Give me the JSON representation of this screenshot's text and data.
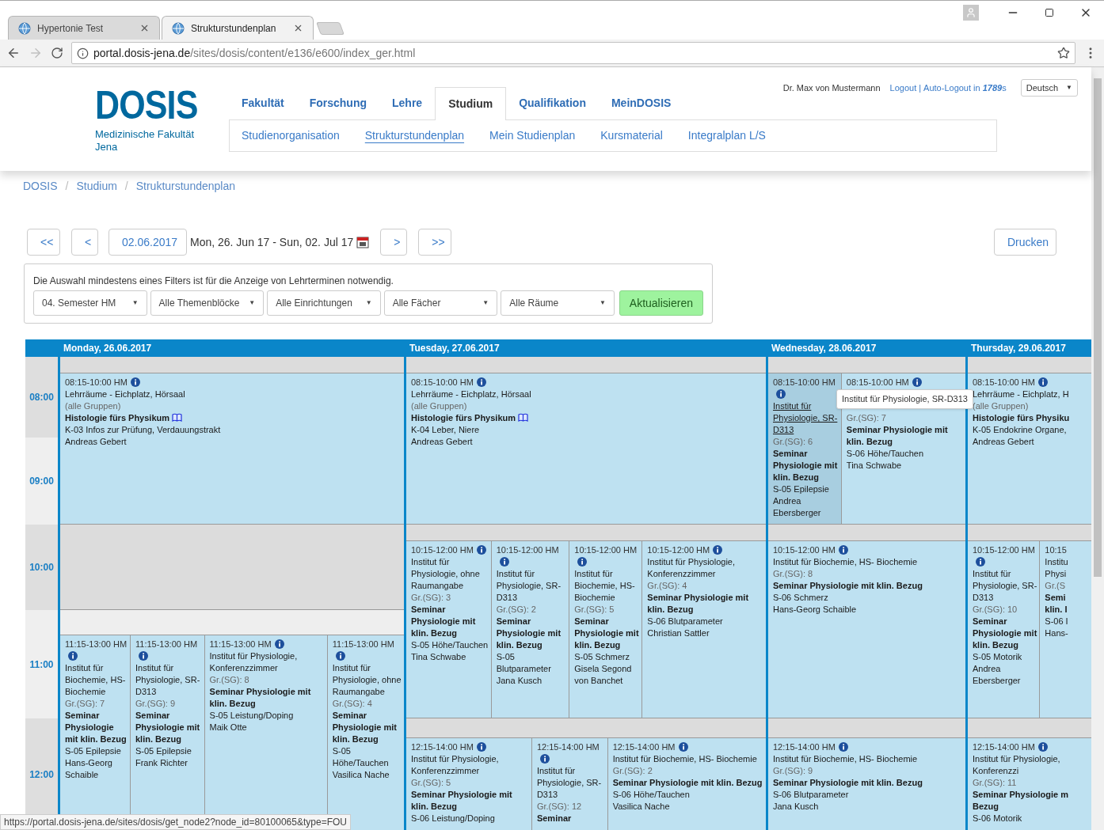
{
  "browser": {
    "tabs": [
      {
        "title": "Hypertonie Test",
        "selected": false
      },
      {
        "title": "Strukturstundenplan",
        "selected": true
      }
    ],
    "url_host": "portal.dosis-jena.de",
    "url_path": "/sites/dosis/content/e136/e600/index_ger.html"
  },
  "logo": {
    "title": "DOSIS",
    "line_1": "Medizinische Fakultät",
    "line_2": "Jena"
  },
  "user": {
    "name": "Dr. Max von Mustermann",
    "logout": "Logout",
    "separator": "|",
    "auto_logout": "Auto-Logout in",
    "seconds": "1789",
    "seconds_unit": "s",
    "language": "Deutsch",
    "language_caret": "▼"
  },
  "main_nav": [
    {
      "label": "Fakultät",
      "selected": false
    },
    {
      "label": "Forschung",
      "selected": false
    },
    {
      "label": "Lehre",
      "selected": false
    },
    {
      "label": "Studium",
      "selected": true
    },
    {
      "label": "Qualifikation",
      "selected": false
    },
    {
      "label": "MeinDOSIS",
      "selected": false
    }
  ],
  "sub_nav": [
    {
      "label": "Studienorganisation",
      "selected": false
    },
    {
      "label": "Strukturstundenplan",
      "selected": true
    },
    {
      "label": "Mein Studienplan",
      "selected": false
    },
    {
      "label": "Kursmaterial",
      "selected": false
    },
    {
      "label": "Integralplan L/S",
      "selected": false
    }
  ],
  "breadcrumb": {
    "separator": "/",
    "items": [
      "DOSIS",
      "Studium",
      "Strukturstundenplan"
    ]
  },
  "toolbar": {
    "first": "<<",
    "prev": "<",
    "date": "02.06.2017",
    "range": "Mon, 26. Jun 17 - Sun, 02. Jul 17",
    "next": ">",
    "last": ">>",
    "print": "Drucken"
  },
  "filter": {
    "note": "Die Auswahl mindestens eines Filters ist für die Anzeige von Lehrterminen notwendig.",
    "selects": [
      "04. Semester HM",
      "Alle Themenblöcke",
      "Alle Einrichtungen",
      "Alle Fächer",
      "Alle Räume"
    ],
    "select_caret": "▼",
    "submit": "Aktualisieren"
  },
  "times": [
    "08:00",
    "09:00",
    "10:00",
    "11:00",
    "12:00"
  ],
  "days": [
    {
      "title": "Monday, 26.06.2017",
      "blocks": [
        {
          "kind": "gap"
        },
        {
          "kind": "events",
          "events": [
            {
              "time": "08:15-10:00 HM",
              "room": "Lehrräume - Eichplatz, Hörsaal",
              "group": "(alle Gruppen)",
              "title": "Histologie fürs Physikum",
              "book": true,
              "topic": "K-03 Infos zur Prüfung, Verdauungstrakt",
              "lecturer": "Andreas Gebert",
              "hovered": false
            }
          ]
        },
        {
          "kind": "gap"
        },
        {
          "kind": "gap"
        },
        {
          "kind": "events",
          "events": [
            {
              "time": "11:15-13:00 HM",
              "room": "Institut für Biochemie, HS-Biochemie",
              "group": "Gr.(SG): 7",
              "title": "Seminar Physiologie mit klin. Bezug",
              "book": false,
              "topic": "S-05 Epilepsie",
              "lecturer": "Hans-Georg Schaible",
              "hovered": false
            },
            {
              "time": "11:15-13:00 HM",
              "room": "Institut für Physiologie, SR-D313",
              "group": "Gr.(SG): 9",
              "title": "Seminar Physiologie mit klin. Bezug",
              "book": false,
              "topic": "S-05 Epilepsie",
              "lecturer": "Frank Richter",
              "hovered": false
            },
            {
              "time": "11:15-13:00 HM",
              "room": "Institut für Physiologie, Konferenzzimmer",
              "group": "Gr.(SG): 8",
              "title": "Seminar Physiologie mit klin. Bezug",
              "book": false,
              "topic": "S-05 Leistung/Doping",
              "lecturer": "Maik Otte",
              "hovered": false
            },
            {
              "time": "11:15-13:00 HM",
              "room": "Institut für Physiologie, ohne Raumangabe",
              "group": "Gr.(SG): 4",
              "title": "Seminar Physiologie mit klin. Bezug",
              "book": false,
              "topic": "S-05 Höhe/Tauchen",
              "lecturer": "Vasilica Nache",
              "hovered": false
            }
          ]
        }
      ]
    },
    {
      "title": "Tuesday, 27.06.2017",
      "blocks": [
        {
          "kind": "gap"
        },
        {
          "kind": "events",
          "events": [
            {
              "time": "08:15-10:00 HM",
              "room": "Lehrräume - Eichplatz, Hörsaal",
              "group": "(alle Gruppen)",
              "title": "Histologie fürs Physikum",
              "book": true,
              "topic": "K-04 Leber, Niere",
              "lecturer": "Andreas Gebert",
              "hovered": false
            }
          ]
        },
        {
          "kind": "gap"
        },
        {
          "kind": "events",
          "events": [
            {
              "time": "10:15-12:00 HM",
              "room": "Institut für Physiologie, ohne Raumangabe",
              "group": "Gr.(SG): 3",
              "title": "Seminar Physiologie mit klin. Bezug",
              "book": false,
              "topic": "S-05 Höhe/Tauchen",
              "lecturer": "Tina Schwabe",
              "hovered": false
            },
            {
              "time": "10:15-12:00 HM",
              "room": "Institut für Physiologie, SR-D313",
              "group": "Gr.(SG): 2",
              "title": "Seminar Physiologie mit klin. Bezug",
              "book": false,
              "topic": "S-05 Blutparameter",
              "lecturer": "Jana Kusch",
              "hovered": false
            },
            {
              "time": "10:15-12:00 HM",
              "room": "Institut für Biochemie, HS-Biochemie",
              "group": "Gr.(SG): 5",
              "title": "Seminar Physiologie mit klin. Bezug",
              "book": false,
              "topic": "S-05 Schmerz",
              "lecturer": "Gisela Segond von Banchet",
              "hovered": false
            },
            {
              "time": "10:15-12:00 HM",
              "room": "Institut für Physiologie, Konferenzzimmer",
              "group": "Gr.(SG): 4",
              "title": "Seminar Physiologie mit klin. Bezug",
              "book": false,
              "topic": "S-06 Blutparameter",
              "lecturer": "Christian Sattler",
              "hovered": false
            }
          ]
        },
        {
          "kind": "gap"
        },
        {
          "kind": "events",
          "events": [
            {
              "time": "12:15-14:00 HM",
              "room": "Institut für Physiologie, Konferenzzimmer",
              "group": "Gr.(SG): 5",
              "title": "Seminar Physiologie mit klin. Bezug",
              "book": false,
              "topic": "S-06 Leistung/Doping",
              "hovered": false
            },
            {
              "time": "12:15-14:00 HM",
              "room": "Institut für Physiologie, SR-D313",
              "group": "Gr.(SG): 12",
              "title": "Seminar",
              "book": false,
              "hovered": false
            },
            {
              "time": "12:15-14:00 HM",
              "room": "Institut für Biochemie, HS- Biochemie",
              "group": "Gr.(SG): 2",
              "title": "Seminar Physiologie mit klin. Bezug",
              "book": false,
              "topic": "S-06 Höhe/Tauchen",
              "lecturer": "Vasilica Nache",
              "hovered": false
            }
          ]
        }
      ]
    },
    {
      "title": "Wednesday, 28.06.2017",
      "blocks": [
        {
          "kind": "gap"
        },
        {
          "kind": "events",
          "events": [
            {
              "time": "08:15-10:00 HM",
              "room": "Institut für Physiologie, SR-D313",
              "group": "Gr.(SG): 6",
              "title": "Seminar Physiologie mit klin. Bezug",
              "book": false,
              "topic": "S-05 Epilepsie",
              "lecturer": "Andrea Ebersberger",
              "hovered": true
            },
            {
              "time": "08:15-10:00 HM",
              "group": "Gr.(SG): 7",
              "title": "Seminar Physiologie mit klin. Bezug",
              "book": false,
              "topic": "S-06 Höhe/Tauchen",
              "lecturer": "Tina Schwabe",
              "hovered": false
            }
          ]
        },
        {
          "kind": "gap"
        },
        {
          "kind": "events",
          "events": [
            {
              "time": "10:15-12:00 HM",
              "room": "Institut für Biochemie, HS- Biochemie",
              "group": "Gr.(SG): 8",
              "title": "Seminar Physiologie mit klin. Bezug",
              "book": false,
              "topic": "S-06 Schmerz",
              "lecturer": "Hans-Georg Schaible",
              "hovered": false
            }
          ]
        },
        {
          "kind": "gap"
        },
        {
          "kind": "events",
          "events": [
            {
              "time": "12:15-14:00 HM",
              "room": "Institut für Biochemie, HS- Biochemie",
              "group": "Gr.(SG): 9",
              "title": "Seminar Physiologie mit klin. Bezug",
              "book": false,
              "topic": "S-06 Blutparameter",
              "lecturer": "Jana Kusch",
              "hovered": false
            }
          ]
        }
      ]
    },
    {
      "title": "Thursday, 29.06.2017",
      "blocks": [
        {
          "kind": "gap"
        },
        {
          "kind": "events",
          "events": [
            {
              "time": "08:15-10:00 HM",
              "room": "Lehrräume - Eichplatz, H",
              "group": "(alle Gruppen)",
              "title": "Histologie fürs Physiku",
              "book": false,
              "topic": "K-05 Endokrine Organe,",
              "lecturer": "Andreas Gebert",
              "hovered": false
            }
          ]
        },
        {
          "kind": "gap"
        },
        {
          "kind": "events",
          "events": [
            {
              "time": "10:15-12:00 HM",
              "room": "Institut für Physiologie, SR-D313",
              "group": "Gr.(SG): 10",
              "title": "Seminar Physiologie mit klin. Bezug",
              "book": false,
              "topic": "S-05 Motorik",
              "lecturer": "Andrea Ebersberger",
              "hovered": false
            },
            {
              "time": "10:15",
              "info": false,
              "room": "Institu Physi",
              "group": "Gr.(S",
              "title": "Semi klin. I",
              "book": false,
              "topic": "S-06 I",
              "lecturer": "Hans-",
              "hovered": false
            }
          ]
        },
        {
          "kind": "gap"
        },
        {
          "kind": "events",
          "events": [
            {
              "time": "12:15-14:00 HM",
              "room": "Institut für Physiologie, Konferenzzi",
              "group": "Gr.(SG): 11",
              "title": "Seminar Physiologie m\nBezug",
              "book": false,
              "topic": "S-06 Motorik",
              "hovered": false
            }
          ]
        }
      ]
    }
  ],
  "tooltip": "Institut für Physiologie, SR-D313",
  "status_url": "https://portal.dosis-jena.de/sites/dosis/get_node2?node_id=80100065&type=FOU"
}
